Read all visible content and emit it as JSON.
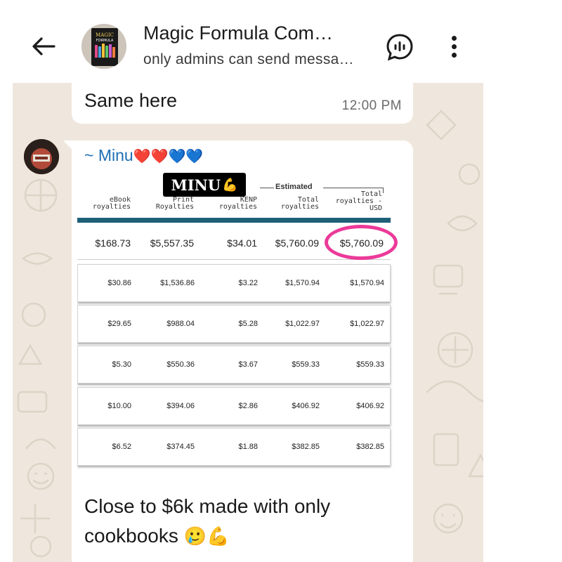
{
  "header": {
    "title": "Magic Formula Com…",
    "subtitle": "only admins can send messa…",
    "avatar_text_top": "MAGIC",
    "avatar_text_bottom": "FORMULA"
  },
  "messages": [
    {
      "text": "Same here",
      "time": "12:00 PM"
    },
    {
      "sender": "~ Minu",
      "sender_hearts": "❤️❤️💙💙",
      "caption": "Close to $6k made with only cookbooks",
      "caption_emoji": "🥲💪"
    }
  ],
  "royalties_image": {
    "badge": "MINU",
    "badge_emoji": "💪",
    "estimated_label": "Estimated",
    "headers": [
      {
        "line1": "eBook",
        "line2": "royalties"
      },
      {
        "line1": "Print",
        "line2": "Royalties"
      },
      {
        "line1": "KENP",
        "line2": "royalties"
      },
      {
        "line1": "Total",
        "line2": "royalties"
      },
      {
        "line1": "Total",
        "line2": "royalties -",
        "line3": "USD"
      }
    ],
    "rows": [
      [
        "$168.73",
        "$5,557.35",
        "$34.01",
        "$5,760.09",
        "$5,760.09"
      ],
      [
        "$30.86",
        "$1,536.86",
        "$3.22",
        "$1,570.94",
        "$1,570.94"
      ],
      [
        "$29.65",
        "$988.04",
        "$5.28",
        "$1,022.97",
        "$1,022.97"
      ],
      [
        "$5.30",
        "$550.36",
        "$3.67",
        "$559.33",
        "$559.33"
      ],
      [
        "$10.00",
        "$394.06",
        "$2.86",
        "$406.92",
        "$406.92"
      ],
      [
        "$6.52",
        "$374.45",
        "$1.88",
        "$382.85",
        "$382.85"
      ]
    ],
    "highlight_color": "#ec3a99"
  },
  "colors": {
    "wallpaper": "#efe7dd",
    "sender_name": "#1e6fb5",
    "table_bar": "#1d6077"
  }
}
